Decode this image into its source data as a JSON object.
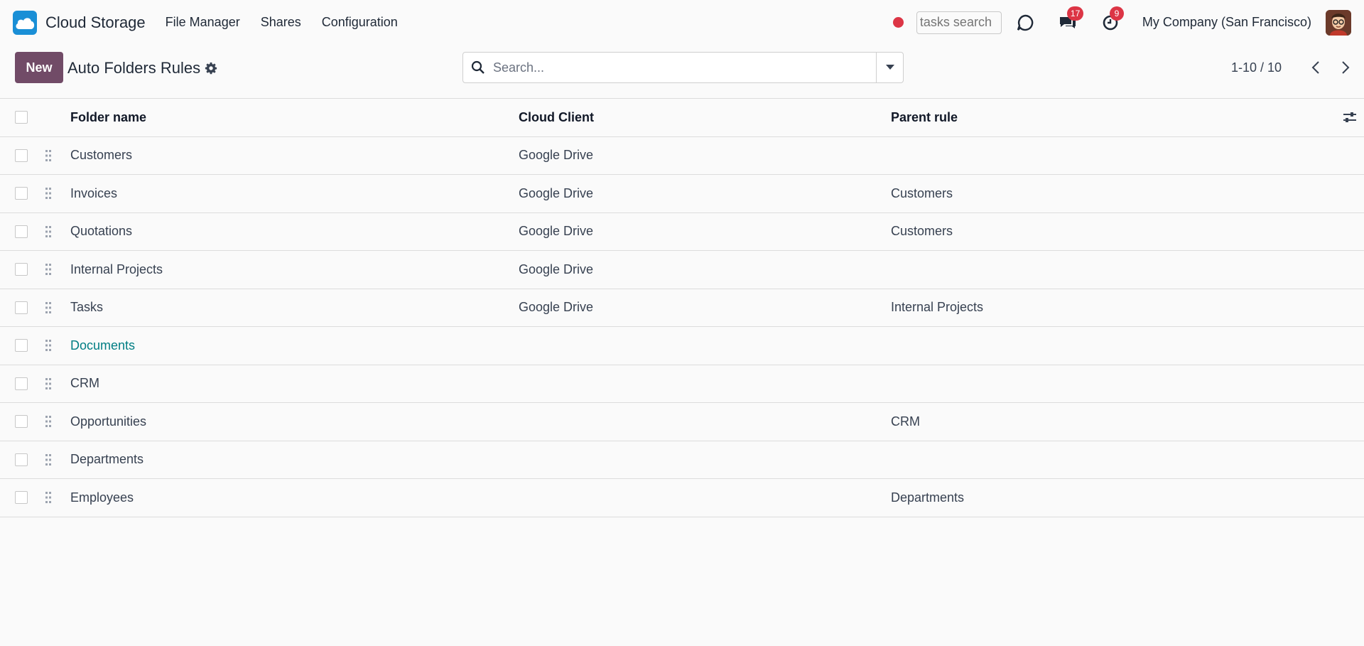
{
  "navbar": {
    "app_name": "Cloud Storage",
    "menu": [
      "File Manager",
      "Shares",
      "Configuration"
    ],
    "tasks_search_placeholder": "tasks search",
    "messages_count": "17",
    "activities_count": "9",
    "company": "My Company (San Francisco)"
  },
  "control": {
    "new_label": "New",
    "title": "Auto Folders Rules",
    "search_placeholder": "Search...",
    "pager": "1-10 / 10"
  },
  "table": {
    "headers": [
      "Folder name",
      "Cloud Client",
      "Parent rule"
    ],
    "rows": [
      {
        "name": "Customers",
        "client": "Google Drive",
        "parent": ""
      },
      {
        "name": "Invoices",
        "client": "Google Drive",
        "parent": "Customers"
      },
      {
        "name": "Quotations",
        "client": "Google Drive",
        "parent": "Customers"
      },
      {
        "name": "Internal Projects",
        "client": "Google Drive",
        "parent": ""
      },
      {
        "name": "Tasks",
        "client": "Google Drive",
        "parent": "Internal Projects"
      },
      {
        "name": "Documents",
        "client": "",
        "parent": ""
      },
      {
        "name": "CRM",
        "client": "",
        "parent": ""
      },
      {
        "name": "Opportunities",
        "client": "",
        "parent": "CRM"
      },
      {
        "name": "Departments",
        "client": "",
        "parent": ""
      },
      {
        "name": "Employees",
        "client": "",
        "parent": "Departments"
      }
    ]
  },
  "colors": {
    "brand": "#714b67",
    "badge": "#dc3545",
    "link": "#017e84",
    "logo": "#1a8fd6"
  }
}
